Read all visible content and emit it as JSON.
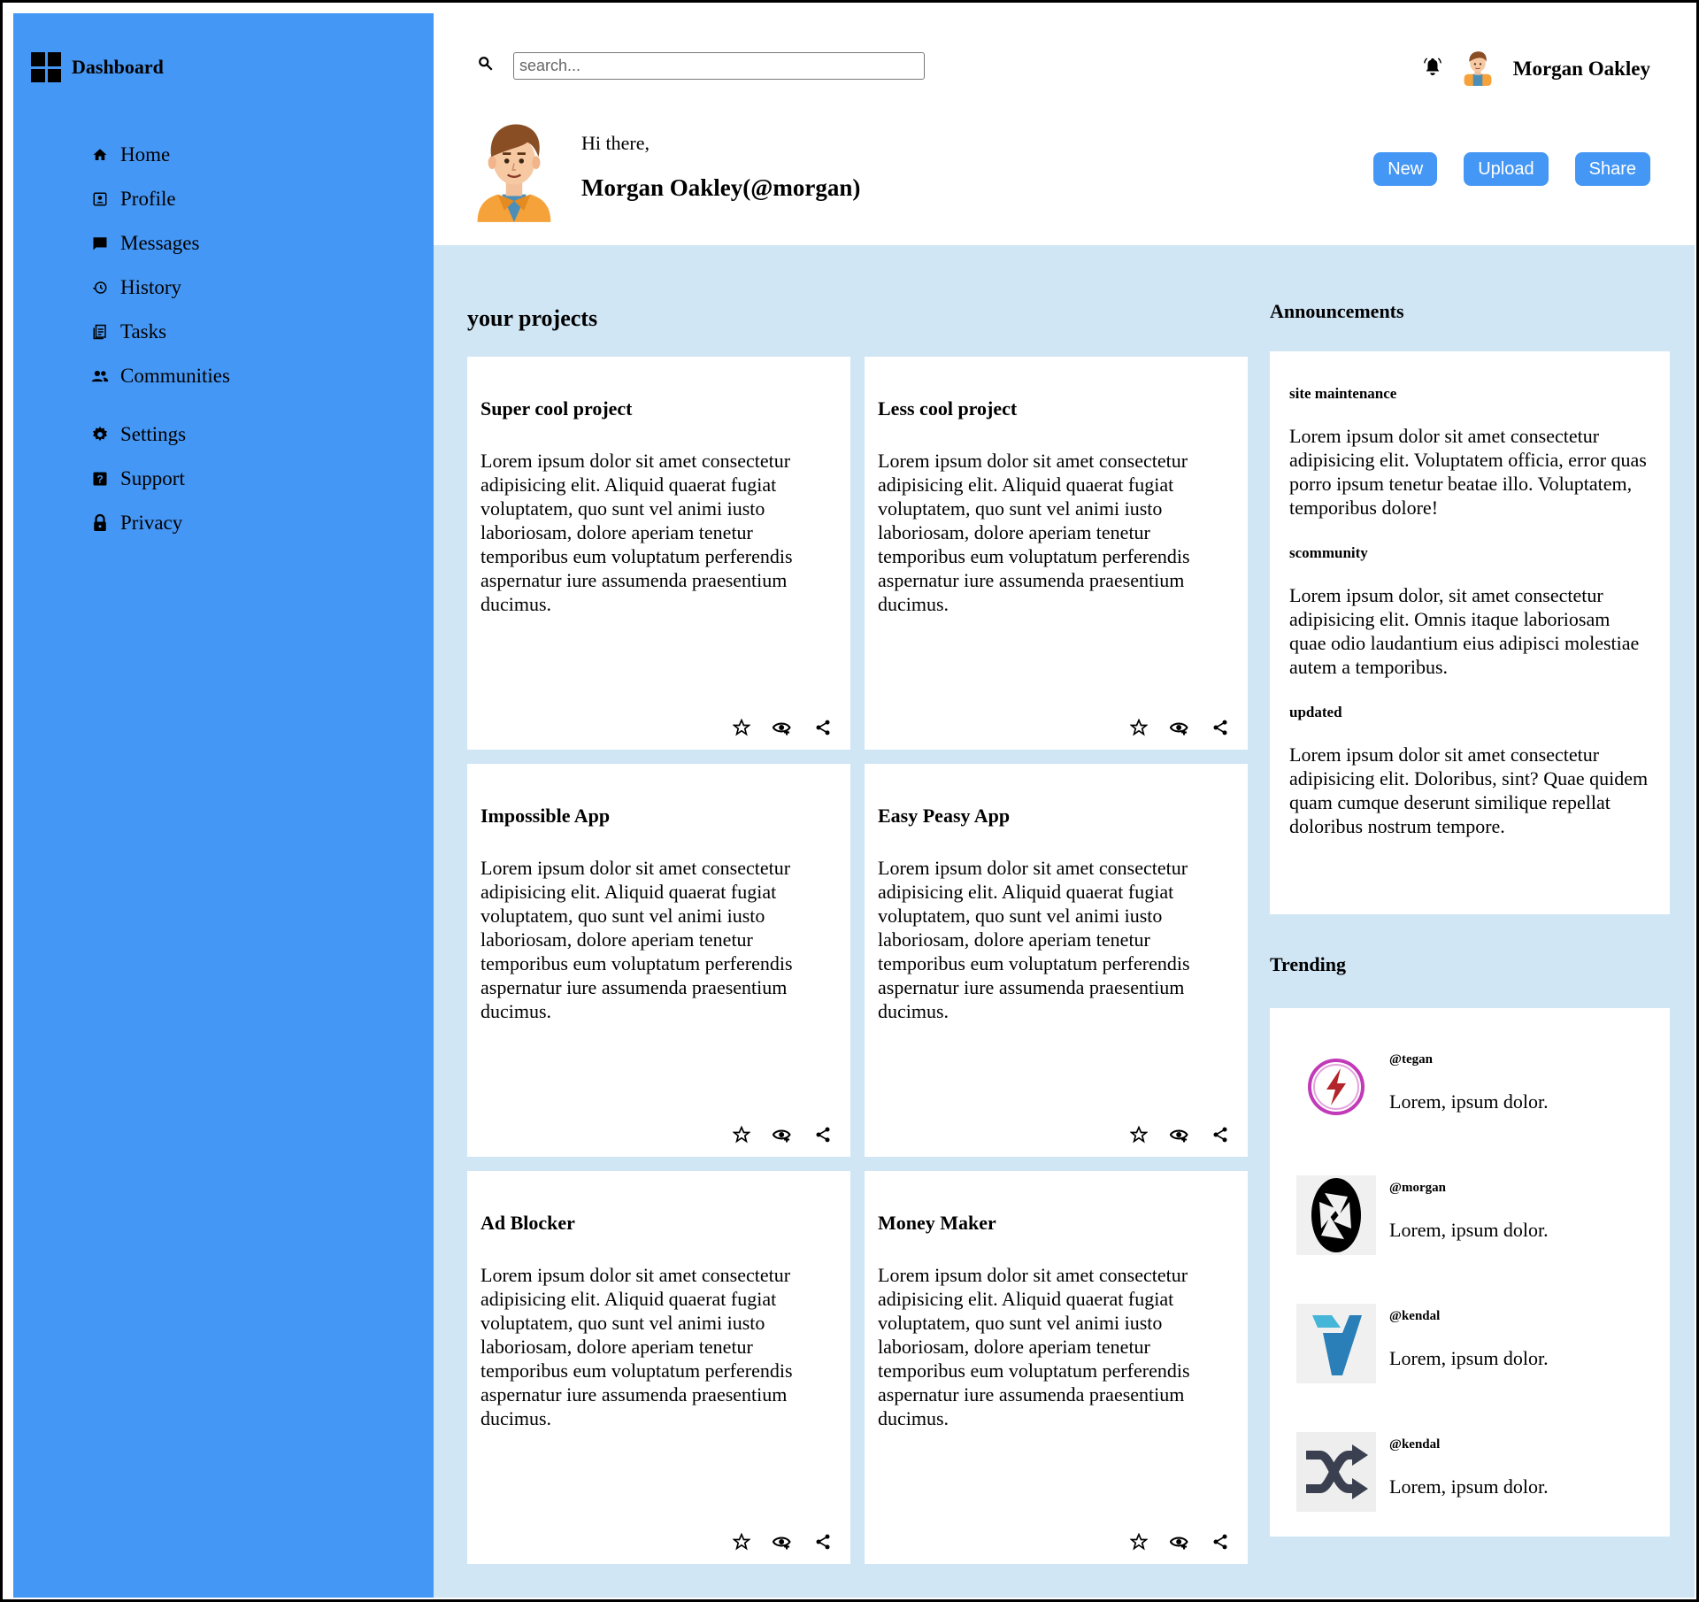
{
  "brand": {
    "title": "Dashboard",
    "icon": "dashboard-icon"
  },
  "sidebar": {
    "items": [
      {
        "label": "Home",
        "icon": "home-icon"
      },
      {
        "label": "Profile",
        "icon": "profile-icon"
      },
      {
        "label": "Messages",
        "icon": "message-icon"
      },
      {
        "label": "History",
        "icon": "history-icon"
      },
      {
        "label": "Tasks",
        "icon": "tasks-icon"
      },
      {
        "label": "Communities",
        "icon": "people-icon"
      }
    ],
    "secondary": [
      {
        "label": "Settings",
        "icon": "gear-icon"
      },
      {
        "label": "Support",
        "icon": "help-icon"
      },
      {
        "label": "Privacy",
        "icon": "lock-icon"
      }
    ]
  },
  "header": {
    "search_placeholder": "search...",
    "user_name": "Morgan Oakley",
    "greeting": "Hi there,",
    "full_handle": "Morgan Oakley(@morgan)",
    "buttons": {
      "new": "New",
      "upload": "Upload",
      "share": "Share"
    }
  },
  "projects": {
    "heading": "your projects",
    "items": [
      {
        "title": "Super cool project",
        "desc": "Lorem ipsum dolor sit amet consectetur adipisicing elit. Aliquid quaerat fugiat voluptatem, quo sunt vel animi iusto laboriosam, dolore aperiam tenetur temporibus eum voluptatum perferendis aspernatur iure assumenda praesentium ducimus."
      },
      {
        "title": "Less cool project",
        "desc": "Lorem ipsum dolor sit amet consectetur adipisicing elit. Aliquid quaerat fugiat voluptatem, quo sunt vel animi iusto laboriosam, dolore aperiam tenetur temporibus eum voluptatum perferendis aspernatur iure assumenda praesentium ducimus."
      },
      {
        "title": "Impossible App",
        "desc": "Lorem ipsum dolor sit amet consectetur adipisicing elit. Aliquid quaerat fugiat voluptatem, quo sunt vel animi iusto laboriosam, dolore aperiam tenetur temporibus eum voluptatum perferendis aspernatur iure assumenda praesentium ducimus."
      },
      {
        "title": "Easy Peasy App",
        "desc": "Lorem ipsum dolor sit amet consectetur adipisicing elit. Aliquid quaerat fugiat voluptatem, quo sunt vel animi iusto laboriosam, dolore aperiam tenetur temporibus eum voluptatum perferendis aspernatur iure assumenda praesentium ducimus."
      },
      {
        "title": "Ad Blocker",
        "desc": "Lorem ipsum dolor sit amet consectetur adipisicing elit. Aliquid quaerat fugiat voluptatem, quo sunt vel animi iusto laboriosam, dolore aperiam tenetur temporibus eum voluptatum perferendis aspernatur iure assumenda praesentium ducimus."
      },
      {
        "title": "Money Maker",
        "desc": "Lorem ipsum dolor sit amet consectetur adipisicing elit. Aliquid quaerat fugiat voluptatem, quo sunt vel animi iusto laboriosam, dolore aperiam tenetur temporibus eum voluptatum perferendis aspernatur iure assumenda praesentium ducimus."
      }
    ]
  },
  "announcements": {
    "heading": "Announcements",
    "items": [
      {
        "title": "site maintenance",
        "text": "Lorem ipsum dolor sit amet consectetur adipisicing elit. Voluptatem officia, error quas porro ipsum tenetur beatae illo. Voluptatem, temporibus dolore!"
      },
      {
        "title": "scommunity",
        "text": "Lorem ipsum dolor, sit amet consectetur adipisicing elit. Omnis itaque laboriosam quae odio laudantium eius adipisci molestiae autem a temporibus."
      },
      {
        "title": "updated",
        "text": "Lorem ipsum dolor sit amet consectetur adipisicing elit. Doloribus, sint? Quae quidem quam cumque deserunt similique repellat doloribus nostrum tempore."
      }
    ]
  },
  "trending": {
    "heading": "Trending",
    "items": [
      {
        "user": "@tegan",
        "text": "Lorem, ipsum dolor.",
        "logo": "lightning-logo-icon"
      },
      {
        "user": "@morgan",
        "text": "Lorem, ipsum dolor.",
        "logo": "aperture-logo-icon"
      },
      {
        "user": "@kendal",
        "text": "Lorem, ipsum dolor.",
        "logo": "v-logo-icon"
      },
      {
        "user": "@kendal",
        "text": "Lorem, ipsum dolor.",
        "logo": "shuffle-logo-icon"
      }
    ]
  },
  "colors": {
    "sidebar": "#4597f5",
    "main_bg": "#d0e6f5",
    "button": "#4597f5"
  }
}
